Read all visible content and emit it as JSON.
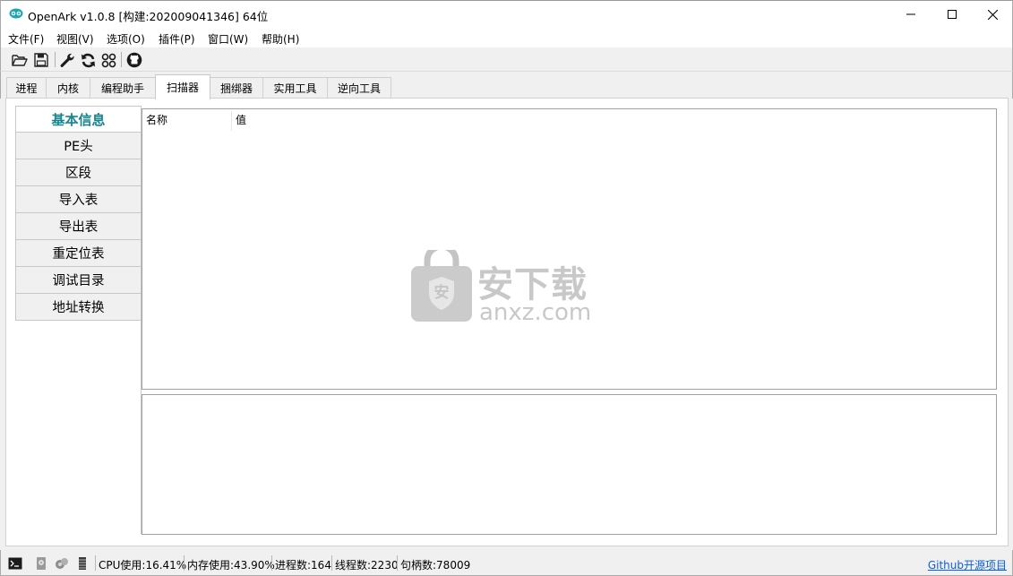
{
  "window": {
    "title": "OpenArk v1.0.8  [构建:202009041346]  64位"
  },
  "menu": [
    "文件(F)",
    "视图(V)",
    "选项(O)",
    "插件(P)",
    "窗口(W)",
    "帮助(H)"
  ],
  "toolbar": {
    "icons": [
      "folder-open-icon",
      "save-icon",
      "wrench-icon",
      "refresh-icon",
      "grid-icon",
      "github-icon"
    ]
  },
  "tabs": [
    "进程",
    "内核",
    "编程助手",
    "扫描器",
    "捆绑器",
    "实用工具",
    "逆向工具"
  ],
  "active_tab": "扫描器",
  "sidebar": {
    "items": [
      "基本信息",
      "PE头",
      "区段",
      "导入表",
      "导出表",
      "重定位表",
      "调试目录",
      "地址转换"
    ]
  },
  "table": {
    "columns": [
      "名称",
      "值"
    ]
  },
  "watermark": {
    "brand": "安下载",
    "domain": "anxz.com",
    "badge": "安"
  },
  "status": {
    "cpu": "CPU使用:16.41%",
    "memory": "内存使用:43.90%",
    "processes": "进程数:164",
    "threads": "线程数:2230",
    "handles": "句柄数:78009",
    "link": "Github开源项目"
  },
  "colors": {
    "accent": "#17868d",
    "link": "#0a60d8"
  }
}
